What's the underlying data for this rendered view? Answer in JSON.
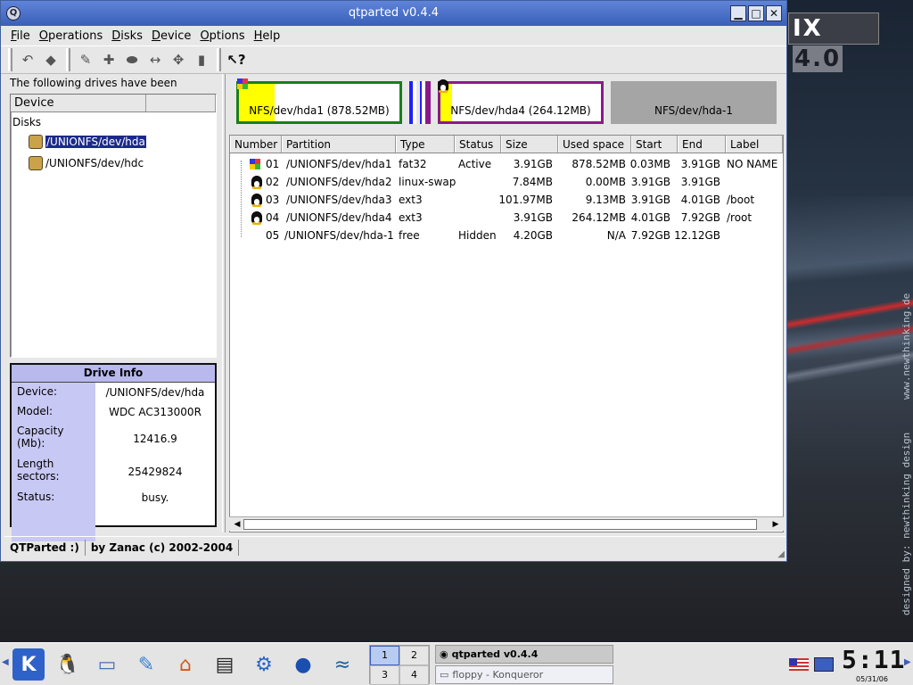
{
  "desktop": {
    "logo_text": "IX",
    "logo_version": "4.0",
    "vertical_url": "www.newthinking.de",
    "vertical_credit": "designed by: newthinking design"
  },
  "window": {
    "title": "qtparted v0.4.4",
    "app_icon": "Q",
    "buttons": {
      "minimize": "▁",
      "maximize": "□",
      "close": "✕"
    }
  },
  "menu": [
    "File",
    "Operations",
    "Disks",
    "Device",
    "Options",
    "Help"
  ],
  "toolbar_icons": [
    "undo-icon",
    "commit-icon",
    "properties-icon",
    "new-partition-icon",
    "delete-partition-icon",
    "resize-icon",
    "move-icon",
    "trash-icon",
    "whats-this-icon"
  ],
  "left": {
    "detected_label": "The following drives have been detected:",
    "tree_columns": [
      "Device",
      ""
    ],
    "tree_root": "Disks",
    "drives": [
      "/UNIONFS/dev/hda",
      "/UNIONFS/dev/hdc"
    ],
    "selected_index": 0
  },
  "drive_info": {
    "title": "Drive Info",
    "rows": [
      {
        "key": "Device:",
        "value": "/UNIONFS/dev/hda"
      },
      {
        "key": "Model:",
        "value": "WDC AC313000R"
      },
      {
        "key": "Capacity (Mb):",
        "value": "12416.9"
      },
      {
        "key": "Length sectors:",
        "value": "25429824"
      },
      {
        "key": "Status:",
        "value": "busy."
      }
    ]
  },
  "disk_map": {
    "p1_label": "NFS/dev/hda1 (878.52MB)",
    "p4_label": "NFS/dev/hda4 (264.12MB)",
    "free_label": "NFS/dev/hda-1",
    "p1_used_fraction": 0.22,
    "p4_used_fraction": 0.07,
    "colors": {
      "p1_border": "#1a7f1a",
      "p4_border": "#8a1a8a",
      "used": "#ffff00",
      "free": "#a5a5a5",
      "swap1": "#2020ff",
      "swap2": "#8a1a8a"
    }
  },
  "partitions": {
    "columns": [
      "Number",
      "Partition",
      "Type",
      "Status",
      "Size",
      "Used space",
      "Start",
      "End",
      "Label"
    ],
    "rows": [
      {
        "number": "01",
        "partition": "/UNIONFS/dev/hda1",
        "type": "fat32",
        "status": "Active",
        "size": "3.91GB",
        "used": "878.52MB",
        "start": "0.03MB",
        "end": "3.91GB",
        "label": "NO NAME",
        "icon": "windows-icon"
      },
      {
        "number": "02",
        "partition": "/UNIONFS/dev/hda2",
        "type": "linux-swap",
        "status": "",
        "size": "7.84MB",
        "used": "0.00MB",
        "start": "3.91GB",
        "end": "3.91GB",
        "label": "",
        "icon": "tux-icon"
      },
      {
        "number": "03",
        "partition": "/UNIONFS/dev/hda3",
        "type": "ext3",
        "status": "",
        "size": "101.97MB",
        "used": "9.13MB",
        "start": "3.91GB",
        "end": "4.01GB",
        "label": "/boot",
        "icon": "tux-icon"
      },
      {
        "number": "04",
        "partition": "/UNIONFS/dev/hda4",
        "type": "ext3",
        "status": "",
        "size": "3.91GB",
        "used": "264.12MB",
        "start": "4.01GB",
        "end": "7.92GB",
        "label": "/root",
        "icon": "tux-icon"
      },
      {
        "number": "05",
        "partition": "/UNIONFS/dev/hda-1",
        "type": "free",
        "status": "Hidden",
        "size": "4.20GB",
        "used": "N/A",
        "start": "7.92GB",
        "end": "12.12GB",
        "label": "",
        "icon": ""
      }
    ]
  },
  "status": {
    "left": "QTParted :)",
    "right": "by Zanac (c) 2002-2004"
  },
  "taskbar": {
    "launchers": [
      "kde-menu-icon",
      "tux-icon",
      "window-list-icon",
      "paint-icon",
      "home-icon",
      "terminal-icon",
      "konqueror-icon",
      "globe-icon",
      "openoffice-icon"
    ],
    "desktops": [
      "1",
      "2",
      "3",
      "4"
    ],
    "current_desktop": "1",
    "tasks": [
      {
        "label": "qtparted v0.4.4",
        "active": true
      },
      {
        "label": "floppy - Konqueror",
        "active": false
      }
    ],
    "clock_time": "5:11",
    "clock_date": "05/31/06"
  }
}
